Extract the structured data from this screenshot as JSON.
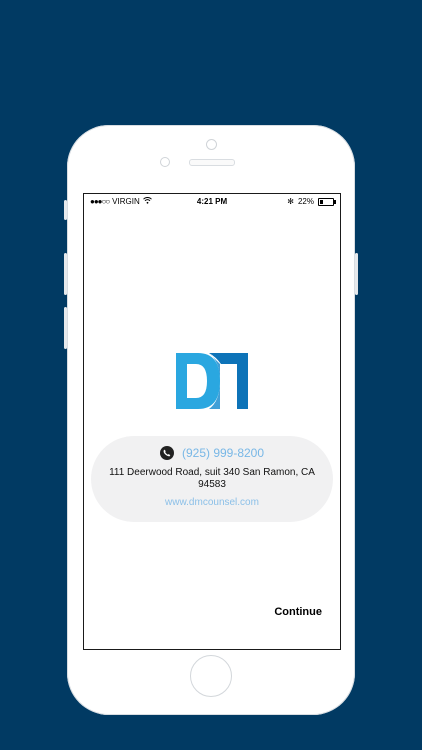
{
  "status_bar": {
    "signal": "●●●○○",
    "carrier": "VIRGIN",
    "time": "4:21 PM",
    "bluetooth": "✻",
    "battery_text": "22%",
    "battery_level": 0.22
  },
  "contact": {
    "phone": "(925) 999-8200",
    "address": "111 Deerwood Road, suit 340 San Ramon, CA 94583",
    "website": "www.dmcounsel.com"
  },
  "actions": {
    "continue_label": "Continue"
  },
  "colors": {
    "background": "#013a63",
    "brand_blue_light": "#2aa7e0",
    "brand_blue_dark": "#0d73b8",
    "link": "#78b7e6"
  },
  "icons": {
    "phone": "phone-icon",
    "wifi": "wifi-icon",
    "bluetooth": "bluetooth-icon",
    "battery": "battery-icon"
  }
}
